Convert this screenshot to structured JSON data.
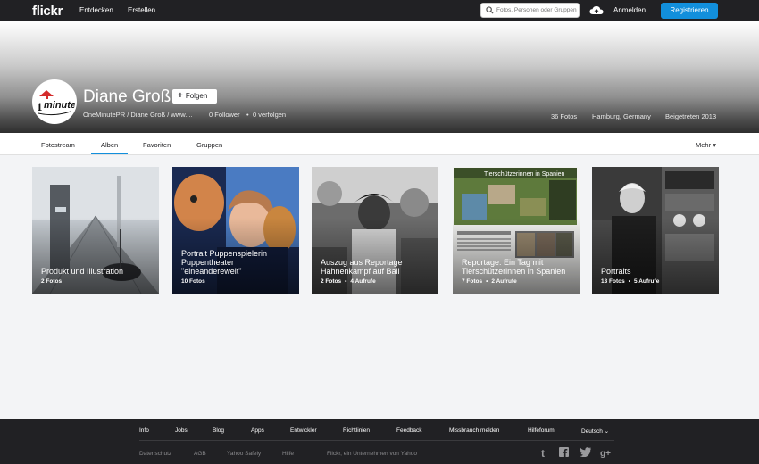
{
  "topnav": {
    "logo": "flickr",
    "links": [
      "Entdecken",
      "Erstellen"
    ],
    "search_placeholder": "Fotos, Personen oder Gruppen",
    "signin": "Anmelden",
    "register": "Registrieren"
  },
  "profile": {
    "name": "Diane Groß",
    "follow_label": "Folgen",
    "subtitle": "OneMinutePR / Diane Groß / www....",
    "followers": "0 Follower",
    "following": "0 verfolgen",
    "photos": "36 Fotos",
    "location": "Hamburg, Germany",
    "joined": "Beigetreten 2013",
    "avatar_text": "minute",
    "avatar_digit": "1"
  },
  "subnav": {
    "tabs": [
      "Fotostream",
      "Alben",
      "Favoriten",
      "Gruppen"
    ],
    "active_tab": "Alben",
    "more": "Mehr"
  },
  "albums": [
    {
      "title": "Produkt und Illustration",
      "photos": "2 Fotos",
      "views": ""
    },
    {
      "title": "Portrait Puppenspielerin Puppentheater \"eineanderewelt\"",
      "photos": "10 Fotos",
      "views": ""
    },
    {
      "title": "Auszug aus Reportage Hahnenkampf auf Bali",
      "photos": "2 Fotos",
      "views": "4 Aufrufe"
    },
    {
      "title": "Reportage: Ein Tag mit Tierschützerinnen in Spanien",
      "photos": "7 Fotos",
      "views": "2 Aufrufe",
      "inner_heading": "Tierschützerinnen in Spanien"
    },
    {
      "title": "Portraits",
      "photos": "13 Fotos",
      "views": "5 Aufrufe"
    }
  ],
  "footer": {
    "links": [
      "Info",
      "Jobs",
      "Blog",
      "Apps",
      "Entwickler",
      "Richtlinien",
      "Feedback",
      "Missbrauch melden",
      "Hilfeforum",
      "Deutsch"
    ],
    "sub_links": [
      "Datenschutz",
      "AGB",
      "Yahoo Safely",
      "Hilfe",
      "Flickr, ein Unternehmen von Yahoo"
    ],
    "social_icons": [
      "tumblr-icon",
      "facebook-icon",
      "twitter-icon",
      "google-plus-icon"
    ]
  },
  "colors": {
    "accent": "#128fdc",
    "nav_bg": "#212124",
    "page_bg": "#f3f4f6"
  }
}
